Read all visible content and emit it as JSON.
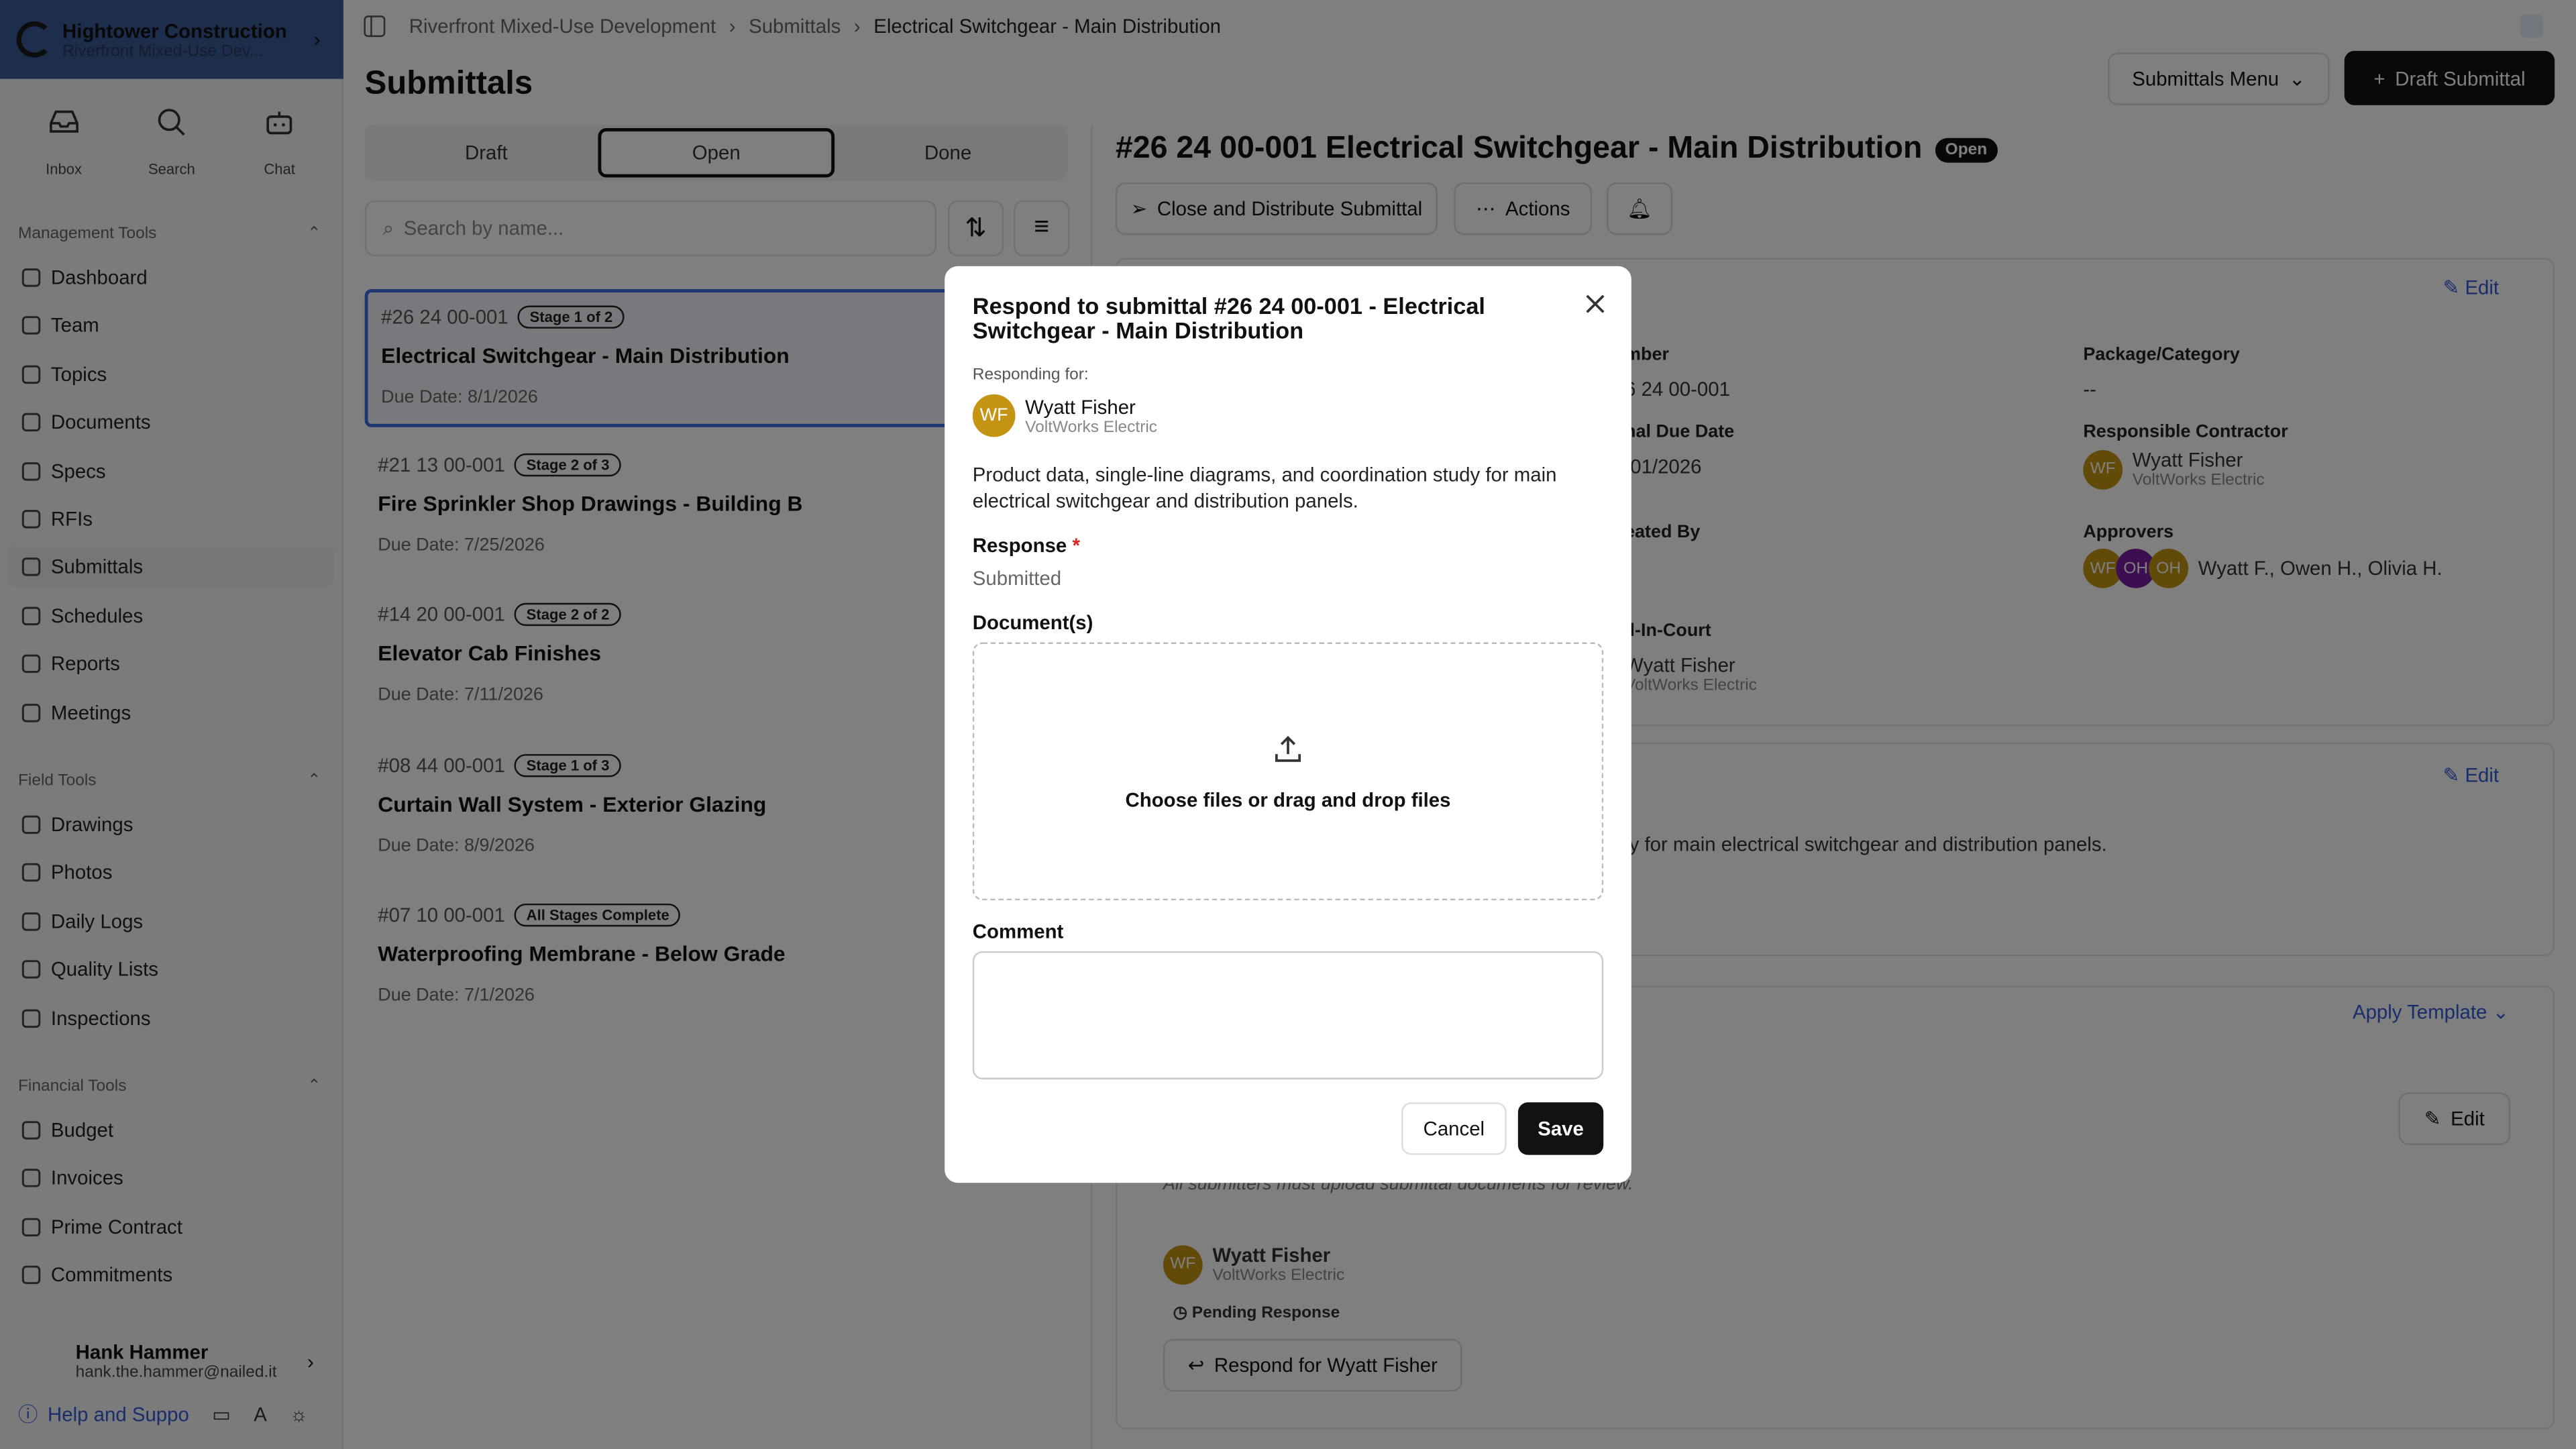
{
  "org": {
    "name": "Hightower Construction",
    "project": "Riverfront Mixed-Use Dev..."
  },
  "topnav": [
    {
      "label": "Inbox"
    },
    {
      "label": "Search"
    },
    {
      "label": "Chat"
    }
  ],
  "sections": {
    "management": "Management Tools",
    "field": "Field Tools",
    "financial": "Financial Tools"
  },
  "nav": {
    "management": [
      "Dashboard",
      "Team",
      "Topics",
      "Documents",
      "Specs",
      "RFIs",
      "Submittals",
      "Schedules",
      "Reports",
      "Meetings"
    ],
    "field": [
      "Drawings",
      "Photos",
      "Daily Logs",
      "Quality Lists",
      "Inspections"
    ],
    "financial": [
      "Budget",
      "Invoices",
      "Prime Contract",
      "Commitments"
    ]
  },
  "user": {
    "name": "Hank Hammer",
    "email": "hank.the.hammer@nailed.it"
  },
  "help": "Help and Suppo",
  "breadcrumb": [
    "Riverfront Mixed-Use Development",
    "Submittals",
    "Electrical Switchgear - Main Distribution"
  ],
  "page_title": "Submittals",
  "menu_label": "Submittals Menu",
  "draft_label": "Draft Submittal",
  "tabs": [
    "Draft",
    "Open",
    "Done"
  ],
  "search_placeholder": "Search by name...",
  "submittals": [
    {
      "num": "#26 24 00-001",
      "stage": "Stage 1 of 2",
      "title": "Electrical Switchgear - Main Distribution",
      "due": "Due Date: 8/1/2026"
    },
    {
      "num": "#21 13 00-001",
      "stage": "Stage 2 of 3",
      "title": "Fire Sprinkler Shop Drawings - Building B",
      "due": "Due Date: 7/25/2026"
    },
    {
      "num": "#14 20 00-001",
      "stage": "Stage 2 of 2",
      "title": "Elevator Cab Finishes",
      "due": "Due Date: 7/11/2026"
    },
    {
      "num": "#08 44 00-001",
      "stage": "Stage 1 of 3",
      "title": "Curtain Wall System - Exterior Glazing",
      "due": "Due Date: 8/9/2026"
    },
    {
      "num": "#07 10 00-001",
      "stage": "All Stages Complete",
      "title": "Waterproofing Membrane - Below Grade",
      "due": "Due Date: 7/1/2026"
    }
  ],
  "detail": {
    "title": "#26 24 00-001 Electrical Switchgear - Main Distribution",
    "status": "Open",
    "close_label": "Close and Distribute Submittal",
    "actions_label": "Actions",
    "edit": "Edit",
    "number_label": "mber",
    "number_value": "6 24 00-001",
    "due_label": "nal Due Date",
    "due_value": "/01/2026",
    "created_label": "eated By",
    "bic_label": "ll-In-Court",
    "package_label": "Package/Category",
    "package_value": "--",
    "contractor_label": "Responsible Contractor",
    "approvers_label": "Approvers",
    "approvers_value": "Wyatt F., Owen H., Olivia H.",
    "description_fragment": "ly for main electrical switchgear and distribution panels.",
    "apply_template": "Apply Template",
    "workflow_note": "All submitters must upload submittal documents for review.",
    "pending": "Pending Response",
    "respond_for": "Respond for Wyatt Fisher"
  },
  "person": {
    "name": "Wyatt Fisher",
    "company": "VoltWorks Electric",
    "initials": "WF"
  },
  "approver_initials": [
    "WF",
    "OH",
    "OH"
  ],
  "modal": {
    "title": "Respond to submittal #26 24 00-001 - Electrical Switchgear - Main Distribution",
    "responding_for": "Responding for:",
    "description": "Product data, single-line diagrams, and coordination study for main electrical switchgear and distribution panels.",
    "response_label": "Response",
    "response_required": "*",
    "response_value": "Submitted",
    "documents_label": "Document(s)",
    "drop_text": "Choose files or drag and drop files",
    "comment_label": "Comment",
    "cancel": "Cancel",
    "save": "Save"
  }
}
